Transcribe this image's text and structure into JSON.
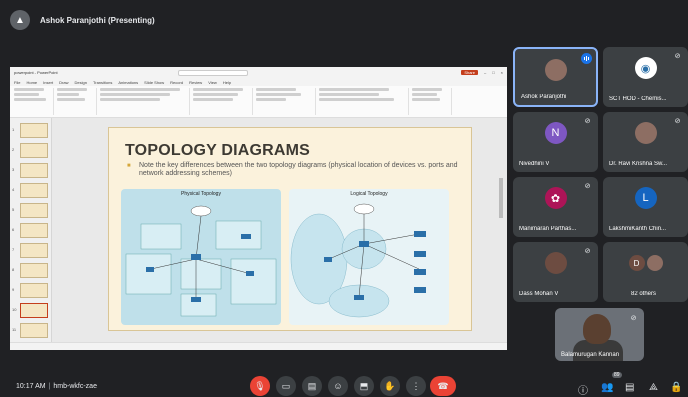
{
  "topbar": {
    "presenter": "Ashok Paranjothi (Presenting)"
  },
  "presentation": {
    "app_title": "powerpoint - PowerPoint",
    "search_placeholder": "Search",
    "menu": [
      "File",
      "Home",
      "Insert",
      "Draw",
      "Design",
      "Transitions",
      "Animations",
      "Slide Show",
      "Record",
      "Review",
      "View",
      "Help"
    ],
    "share_label": "Share",
    "slide": {
      "title": "TOPOLOGY DIAGRAMS",
      "bullet": "Note the key differences between the two topology diagrams (physical location of devices vs. ports and network addressing schemes)",
      "physical_label": "Physical Topology",
      "logical_label": "Logical Topology"
    },
    "thumbnails": [
      "1",
      "2",
      "3",
      "4",
      "5",
      "6",
      "7",
      "8",
      "9",
      "10",
      "11"
    ]
  },
  "participants": [
    {
      "name": "Ashok Paranjothi",
      "initial": "A",
      "color": "#8d6e63",
      "speaking": true
    },
    {
      "name": "SCT HOD - Chemis...",
      "initial": "S",
      "color": "#ffffff",
      "muted": true
    },
    {
      "name": "Nivedhini V",
      "initial": "N",
      "color": "#7e57c2",
      "muted": true
    },
    {
      "name": "Dr. Ravi Krishna Sw...",
      "initial": "R",
      "color": "#8d6e63",
      "muted": true
    },
    {
      "name": "Manimaran Parthas...",
      "initial": "M",
      "color": "#ad1457",
      "muted": true
    },
    {
      "name": "LakshmiKanth Chin...",
      "initial": "L",
      "color": "#1565c0",
      "muted": false
    },
    {
      "name": "Dass Mohan V",
      "initial": "D",
      "color": "#6d4c41",
      "muted": true
    },
    {
      "name": "82 others",
      "initial": "D",
      "color": "#5f6368"
    }
  ],
  "selfview": {
    "name": "Balamurugan Kannan"
  },
  "bottombar": {
    "time": "10:17 AM",
    "meeting_code": "hmb-wkfc-zae",
    "participant_count": "89"
  }
}
